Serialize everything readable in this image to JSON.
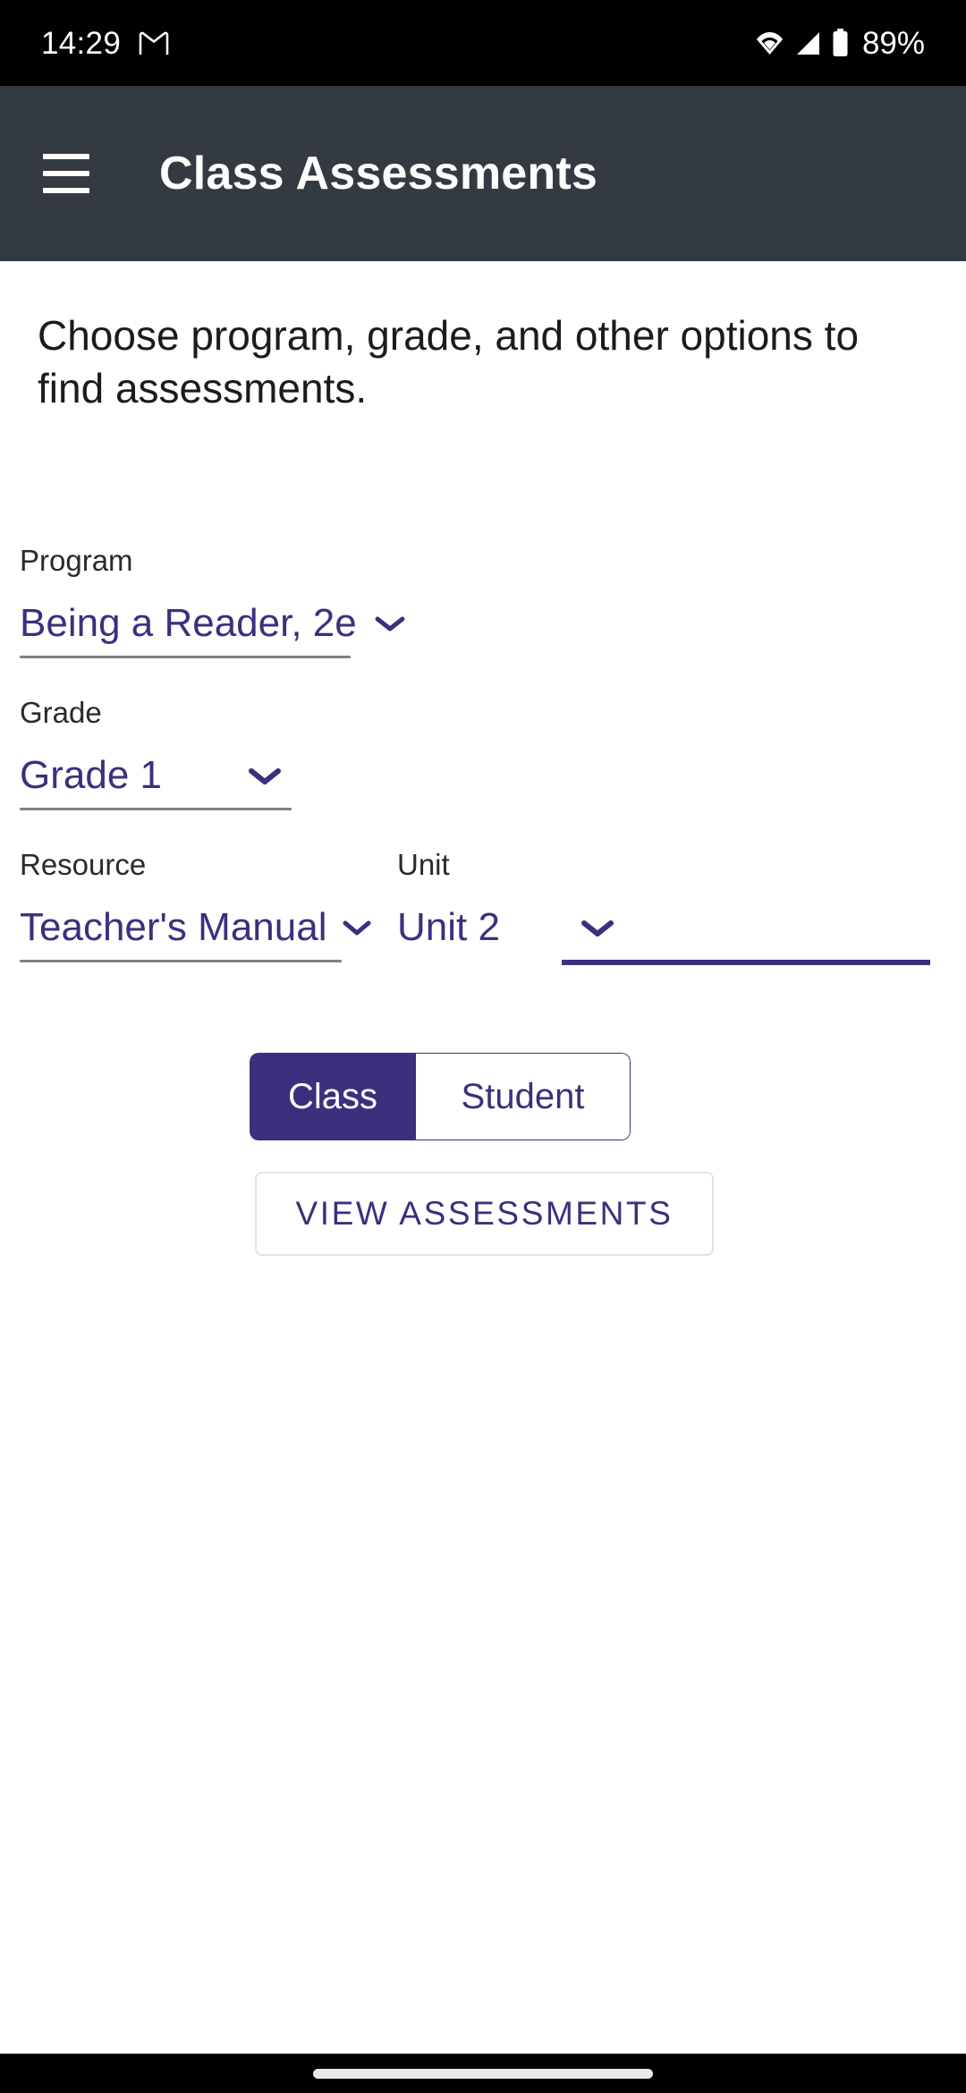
{
  "status_bar": {
    "time": "14:29",
    "notification_icon": "gmail-icon",
    "wifi_icon": "wifi-icon",
    "signal_icon": "cellular-signal-icon",
    "battery_icon": "battery-icon",
    "battery_percent": "89%"
  },
  "app_bar": {
    "menu_icon": "hamburger-menu-icon",
    "title": "Class Assessments"
  },
  "main": {
    "intro": "Choose program, grade, and other options to find assessments.",
    "fields": [
      {
        "label": "Program",
        "value": "Being a Reader, 2e",
        "chevron": "chevron-down-icon",
        "focused": false
      },
      {
        "label": "Grade",
        "value": "Grade 1",
        "chevron": "chevron-down-icon",
        "focused": false
      },
      {
        "label": "Resource",
        "value": "Teacher's Manual",
        "chevron": "chevron-down-icon",
        "focused": false
      },
      {
        "label": "Unit",
        "value": "Unit 2",
        "chevron": "chevron-down-icon",
        "focused": true
      }
    ],
    "scope_toggle": {
      "selected": "Class",
      "options": [
        {
          "label": "Class",
          "selected": true
        },
        {
          "label": "Student",
          "selected": false
        }
      ]
    },
    "view_button_label": "VIEW ASSESSMENTS"
  },
  "colors": {
    "accent_purple": "#3d2f7e",
    "app_bar_bg": "#343a41",
    "underline_grey": "#808080",
    "button_border": "#e2e2e2"
  },
  "nav_bar": {
    "gesture_pill": "home-gesture-pill"
  }
}
